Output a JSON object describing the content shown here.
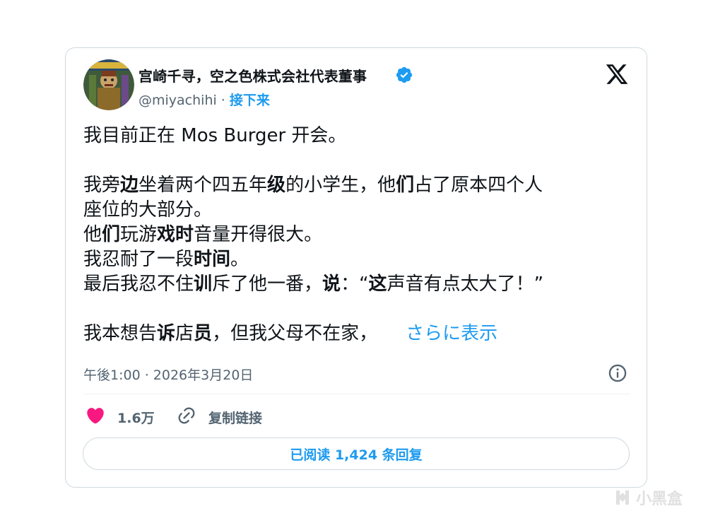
{
  "tweet": {
    "display_name": "宫崎千寻，空之色株式会社代表董事",
    "handle": "@miyachihi",
    "separator": " · ",
    "follow_label": "接下来",
    "lines": {
      "l1": "我目前正在 Mos Burger 开会。",
      "l2a": "我旁",
      "l2b": "边",
      "l2c": "坐着两个四五年",
      "l2d": "级",
      "l2e": "的小学生，他",
      "l2f": "们",
      "l2g": "占了原本四个人",
      "l3": "座位的大部分。",
      "l4a": "他",
      "l4b": "们",
      "l4c": "玩游",
      "l4d": "戏时",
      "l4e": "音量开得很大。",
      "l5a": "我忍耐了一段",
      "l5b": "时间",
      "l5c": "。",
      "l6a": "最后我忍不住",
      "l6b": "训",
      "l6c": "斥了他一番，",
      "l6d": "说",
      "l6e": "：“",
      "l6f": "这",
      "l6g": "声音有点太大了！”",
      "l7a": "我本想告",
      "l7b": "诉",
      "l7c": "店",
      "l7d": "员",
      "l7e": "，但我父母不在家，"
    },
    "show_more_label": "さらに表示",
    "timestamp": "午後1:00 · 2026年3月20日",
    "like_count": "1.6万",
    "copy_link_label": "复制链接",
    "read_replies_label": "已阅读 1,424 条回复"
  },
  "icons": {
    "verified": "verified-badge-icon",
    "logo": "x-logo-icon",
    "info": "info-icon",
    "like": "heart-icon",
    "link": "link-icon",
    "watermark": "xiaoheihe-logo-icon"
  },
  "watermark": {
    "text": "小黑盒"
  },
  "colors": {
    "accent": "#1d9bf0",
    "like": "#f91880",
    "secondary_text": "#536471",
    "border": "#cfd9de"
  }
}
